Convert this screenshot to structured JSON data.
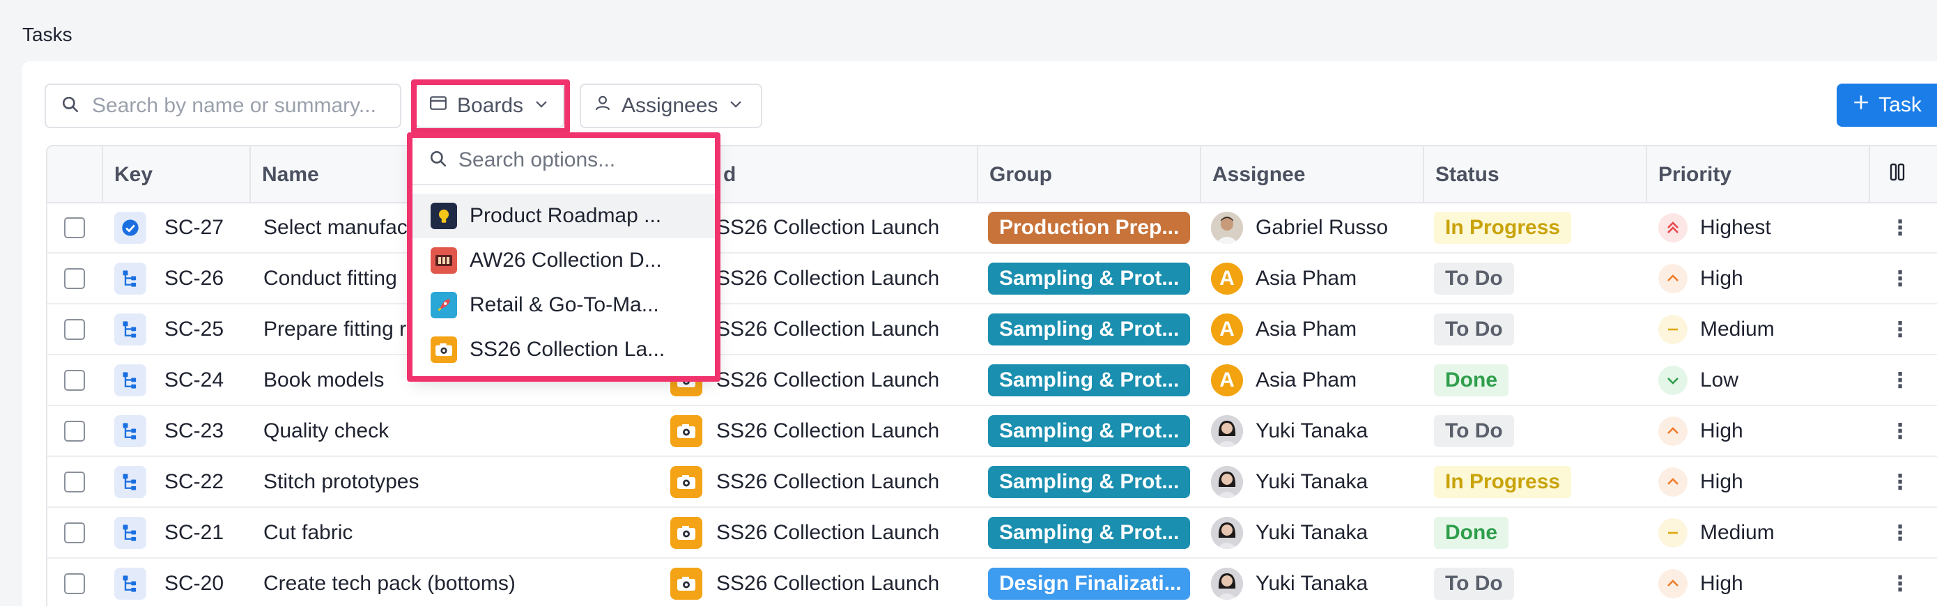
{
  "page": {
    "title": "Tasks"
  },
  "toolbar": {
    "search_placeholder": "Search by name or summary...",
    "boards_label": "Boards",
    "assignees_label": "Assignees",
    "add_task_label": "Task"
  },
  "boards_dropdown": {
    "search_placeholder": "Search options...",
    "options": [
      {
        "label": "Product Roadmap ...",
        "icon": "lightbulb-icon",
        "color": "#1f2a44"
      },
      {
        "label": "AW26 Collection D...",
        "icon": "film-icon",
        "color": "#e2574c"
      },
      {
        "label": "Retail & Go-To-Ma...",
        "icon": "rocket-icon",
        "color": "#2aa7d6"
      },
      {
        "label": "SS26 Collection La...",
        "icon": "camera-icon",
        "color": "#f4a316"
      }
    ]
  },
  "table": {
    "columns": {
      "key": "Key",
      "name": "Name",
      "board": "d",
      "group": "Group",
      "assignee": "Assignee",
      "status": "Status",
      "priority": "Priority"
    },
    "rows": [
      {
        "key": "SC-27",
        "type": "check",
        "name": "Select manufact",
        "board": "SS26 Collection Launch",
        "group": "Production Prep...",
        "group_color": "#c8733a",
        "assignee": "Gabriel Russo",
        "avatar": "photo-m",
        "status": "In Progress",
        "priority": "Highest"
      },
      {
        "key": "SC-26",
        "type": "subtask",
        "name": "Conduct fitting",
        "board": "SS26 Collection Launch",
        "group": "Sampling & Prot...",
        "group_color": "#1a8fb0",
        "assignee": "Asia Pham",
        "avatar": "A",
        "status": "To Do",
        "priority": "High"
      },
      {
        "key": "SC-25",
        "type": "subtask",
        "name": "Prepare fitting r",
        "board": "SS26 Collection Launch",
        "group": "Sampling & Prot...",
        "group_color": "#1a8fb0",
        "assignee": "Asia Pham",
        "avatar": "A",
        "status": "To Do",
        "priority": "Medium"
      },
      {
        "key": "SC-24",
        "type": "subtask",
        "name": "Book models",
        "board": "SS26 Collection Launch",
        "group": "Sampling & Prot...",
        "group_color": "#1a8fb0",
        "assignee": "Asia Pham",
        "avatar": "A",
        "status": "Done",
        "priority": "Low"
      },
      {
        "key": "SC-23",
        "type": "subtask",
        "name": "Quality check",
        "board": "SS26 Collection Launch",
        "group": "Sampling & Prot...",
        "group_color": "#1a8fb0",
        "assignee": "Yuki Tanaka",
        "avatar": "photo-f",
        "status": "To Do",
        "priority": "High"
      },
      {
        "key": "SC-22",
        "type": "subtask",
        "name": "Stitch prototypes",
        "board": "SS26 Collection Launch",
        "group": "Sampling & Prot...",
        "group_color": "#1a8fb0",
        "assignee": "Yuki Tanaka",
        "avatar": "photo-f",
        "status": "In Progress",
        "priority": "High"
      },
      {
        "key": "SC-21",
        "type": "subtask",
        "name": "Cut fabric",
        "board": "SS26 Collection Launch",
        "group": "Sampling & Prot...",
        "group_color": "#1a8fb0",
        "assignee": "Yuki Tanaka",
        "avatar": "photo-f",
        "status": "Done",
        "priority": "Medium"
      },
      {
        "key": "SC-20",
        "type": "subtask",
        "name": "Create tech pack (bottoms)",
        "board": "SS26 Collection Launch",
        "group": "Design Finalizati...",
        "group_color": "#3d9bf0",
        "assignee": "Yuki Tanaka",
        "avatar": "photo-f",
        "status": "To Do",
        "priority": "High"
      }
    ]
  },
  "colors": {
    "accent": "#1a7de8",
    "highlight": "#f0336c",
    "status_in_progress_bg": "#fdf8d6",
    "status_in_progress_fg": "#c9a30a",
    "status_todo_bg": "#eeeff1",
    "status_todo_fg": "#5a606b",
    "status_done_bg": "#e6f7ea",
    "status_done_fg": "#2f9e4b"
  }
}
